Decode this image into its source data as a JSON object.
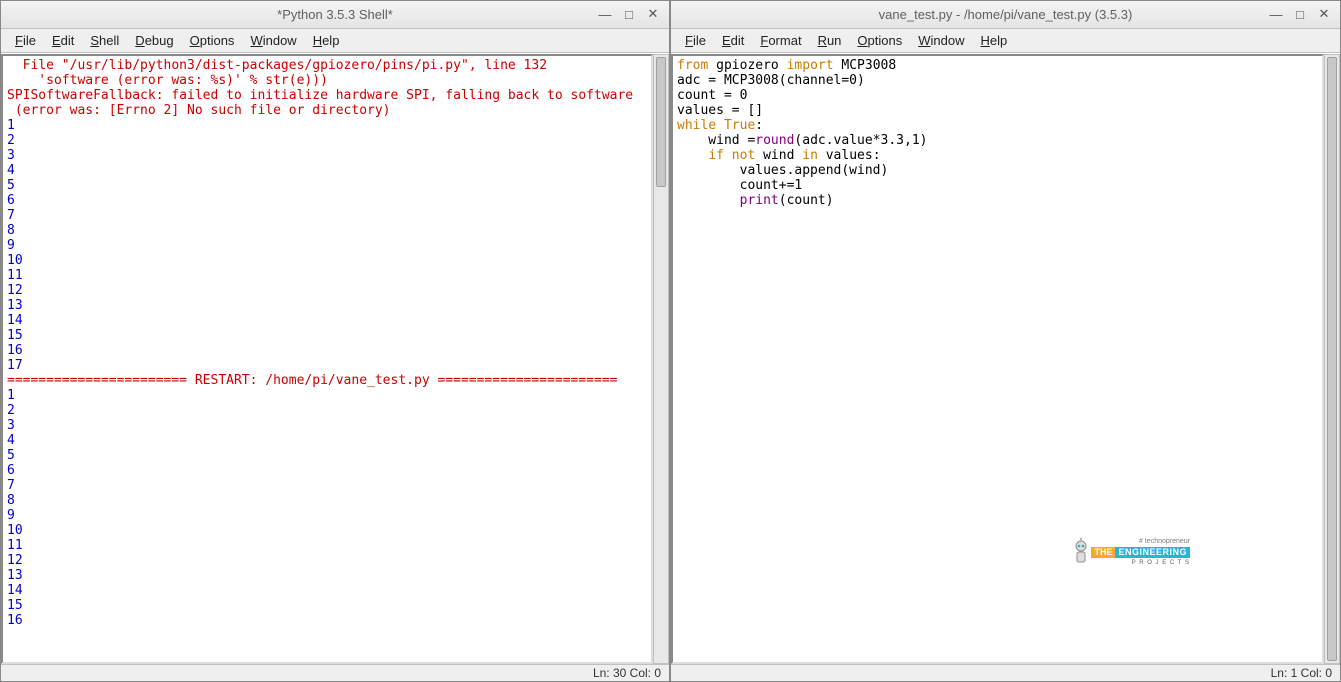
{
  "left": {
    "title": "*Python 3.5.3 Shell*",
    "menus": [
      "File",
      "Edit",
      "Shell",
      "Debug",
      "Options",
      "Window",
      "Help"
    ],
    "status": "Ln: 30  Col: 0",
    "lines": [
      {
        "cls": "tok-err",
        "text": "  File \"/usr/lib/python3/dist-packages/gpiozero/pins/pi.py\", line 132"
      },
      {
        "cls": "tok-err",
        "text": "    'software (error was: %s)' % str(e)))"
      },
      {
        "cls": "tok-err",
        "text": "SPISoftwareFallback: failed to initialize hardware SPI, falling back to software"
      },
      {
        "cls": "tok-err",
        "text": " (error was: [Errno 2] No such file or directory)"
      },
      {
        "cls": "tok-out",
        "text": "1"
      },
      {
        "cls": "tok-out",
        "text": "2"
      },
      {
        "cls": "tok-out",
        "text": "3"
      },
      {
        "cls": "tok-out",
        "text": "4"
      },
      {
        "cls": "tok-out",
        "text": "5"
      },
      {
        "cls": "tok-out",
        "text": "6"
      },
      {
        "cls": "tok-out",
        "text": "7"
      },
      {
        "cls": "tok-out",
        "text": "8"
      },
      {
        "cls": "tok-out",
        "text": "9"
      },
      {
        "cls": "tok-out",
        "text": "10"
      },
      {
        "cls": "tok-out",
        "text": "11"
      },
      {
        "cls": "tok-out",
        "text": "12"
      },
      {
        "cls": "tok-out",
        "text": "13"
      },
      {
        "cls": "tok-out",
        "text": "14"
      },
      {
        "cls": "tok-out",
        "text": "15"
      },
      {
        "cls": "tok-out",
        "text": "16"
      },
      {
        "cls": "tok-out",
        "text": "17"
      },
      {
        "cls": "tok-txt",
        "text": ""
      },
      {
        "cls": "tok-err",
        "text": "======================= RESTART: /home/pi/vane_test.py ======================="
      },
      {
        "cls": "tok-out",
        "text": "1"
      },
      {
        "cls": "tok-out",
        "text": "2"
      },
      {
        "cls": "tok-out",
        "text": "3"
      },
      {
        "cls": "tok-out",
        "text": "4"
      },
      {
        "cls": "tok-out",
        "text": "5"
      },
      {
        "cls": "tok-out",
        "text": "6"
      },
      {
        "cls": "tok-out",
        "text": "7"
      },
      {
        "cls": "tok-out",
        "text": "8"
      },
      {
        "cls": "tok-out",
        "text": "9"
      },
      {
        "cls": "tok-out",
        "text": "10"
      },
      {
        "cls": "tok-out",
        "text": "11"
      },
      {
        "cls": "tok-out",
        "text": "12"
      },
      {
        "cls": "tok-out",
        "text": "13"
      },
      {
        "cls": "tok-out",
        "text": "14"
      },
      {
        "cls": "tok-out",
        "text": "15"
      },
      {
        "cls": "tok-out",
        "text": "16"
      }
    ]
  },
  "right": {
    "title": "vane_test.py - /home/pi/vane_test.py (3.5.3)",
    "menus": [
      "File",
      "Edit",
      "Format",
      "Run",
      "Options",
      "Window",
      "Help"
    ],
    "status": "Ln: 1  Col: 0",
    "code": [
      {
        "parts": [
          [
            "tok-kw",
            "from"
          ],
          [
            "",
            " gpiozero "
          ],
          [
            "tok-kw",
            "import"
          ],
          [
            "",
            " MCP3008"
          ]
        ]
      },
      {
        "parts": [
          [
            "",
            "adc = MCP3008(channel=0)"
          ]
        ]
      },
      {
        "parts": [
          [
            "",
            "count = 0"
          ]
        ]
      },
      {
        "parts": [
          [
            "",
            "values = []"
          ]
        ]
      },
      {
        "parts": [
          [
            "tok-kw",
            "while"
          ],
          [
            "",
            " "
          ],
          [
            "tok-kw",
            "True"
          ],
          [
            "",
            ":"
          ]
        ]
      },
      {
        "parts": [
          [
            "",
            "    wind ="
          ],
          [
            "tok-bi",
            "round"
          ],
          [
            "",
            "(adc.value*3.3,1)"
          ]
        ]
      },
      {
        "parts": [
          [
            "",
            "    "
          ],
          [
            "tok-kw",
            "if"
          ],
          [
            "",
            " "
          ],
          [
            "tok-kw",
            "not"
          ],
          [
            "",
            " wind "
          ],
          [
            "tok-kw",
            "in"
          ],
          [
            "",
            " values:"
          ]
        ]
      },
      {
        "parts": [
          [
            "",
            "        values.append(wind)"
          ]
        ]
      },
      {
        "parts": [
          [
            "",
            "        count+=1"
          ]
        ]
      },
      {
        "parts": [
          [
            "",
            "        "
          ],
          [
            "tok-bi",
            "print"
          ],
          [
            "",
            "(count)"
          ]
        ]
      }
    ],
    "watermark": {
      "small": "# technopreneur",
      "the": "THE",
      "eng": "ENGINEERING",
      "proj": "P R O J E C T S"
    }
  },
  "winctl": {
    "min": "—",
    "max": "□",
    "close": "✕"
  }
}
